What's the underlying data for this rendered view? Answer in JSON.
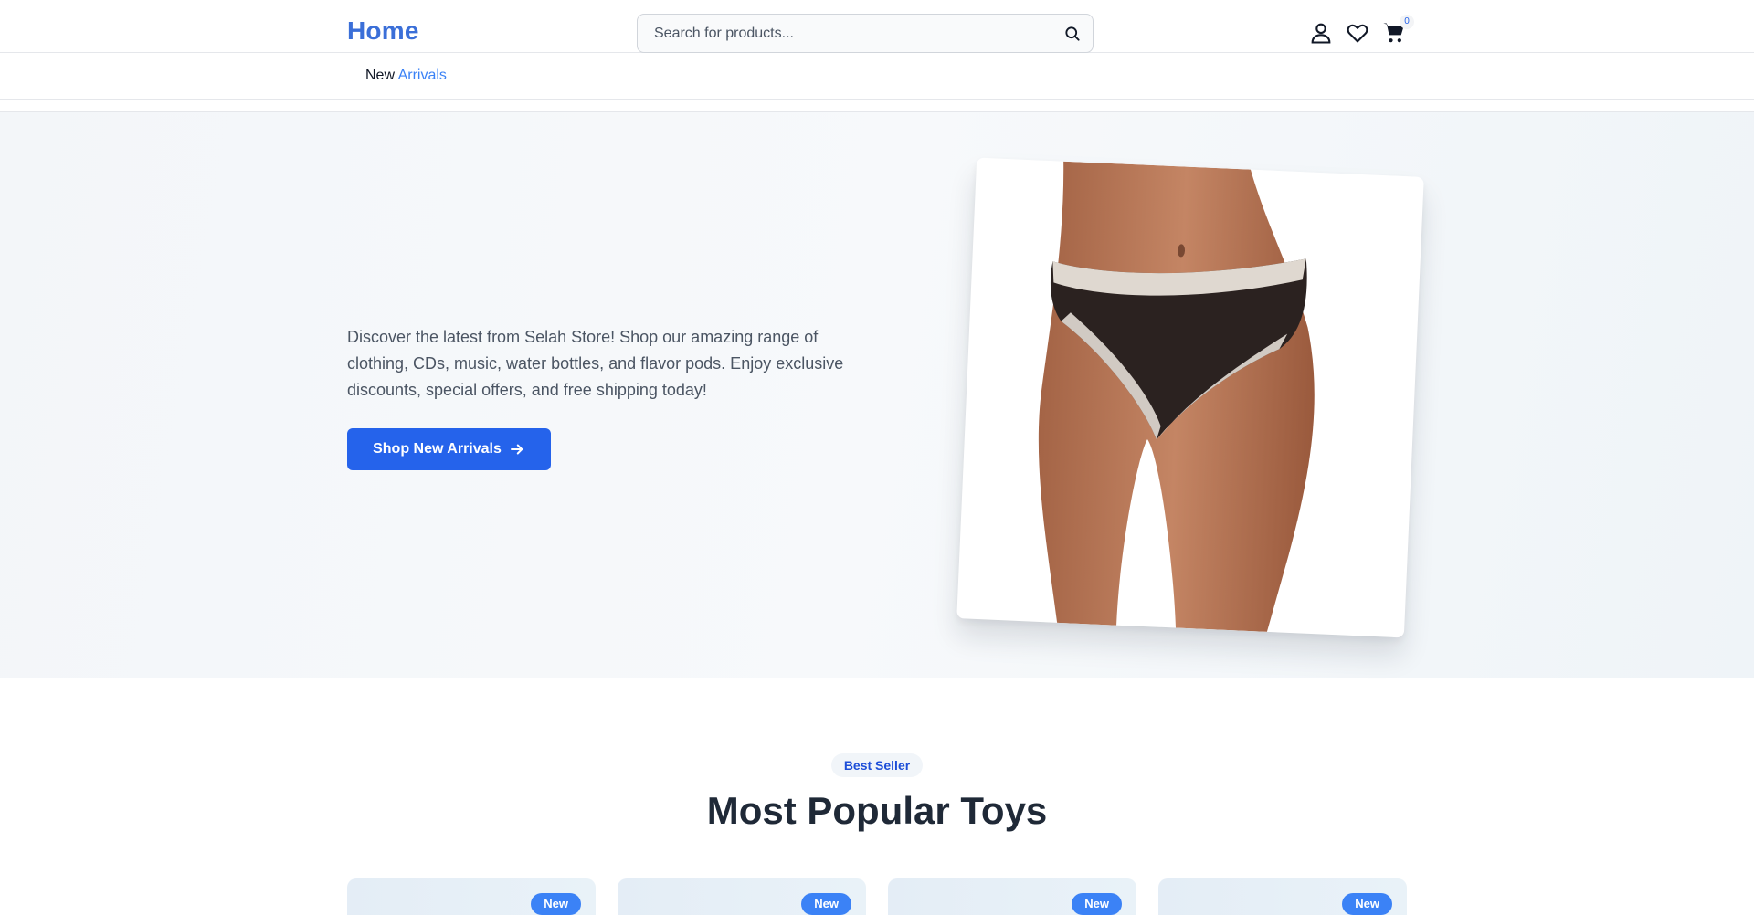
{
  "header": {
    "logo": "Home",
    "search_placeholder": "Search for products...",
    "cart_count": "0",
    "icons": [
      "search-icon",
      "user-icon",
      "heart-icon",
      "cart-icon"
    ]
  },
  "subnav": {
    "link_word1": "New",
    "link_word2": "Arrivals"
  },
  "hero": {
    "description": "Discover the latest from Selah Store! Shop our amazing range of clothing, CDs, music, water bottles, and flavor pods. Enjoy exclusive discounts, special offers, and free shipping today!",
    "cta_label": "Shop New Arrivals",
    "image_alt": "Black lace briefs product photo"
  },
  "best_seller": {
    "badge": "Best Seller",
    "title": "Most Popular Toys"
  },
  "products": [
    {
      "badge": "New"
    },
    {
      "badge": "New"
    },
    {
      "badge": "New"
    },
    {
      "badge": "New"
    }
  ],
  "colors": {
    "brand": "#3b6fd8",
    "accent": "#2563eb",
    "badge_blue": "#3b82f6"
  }
}
